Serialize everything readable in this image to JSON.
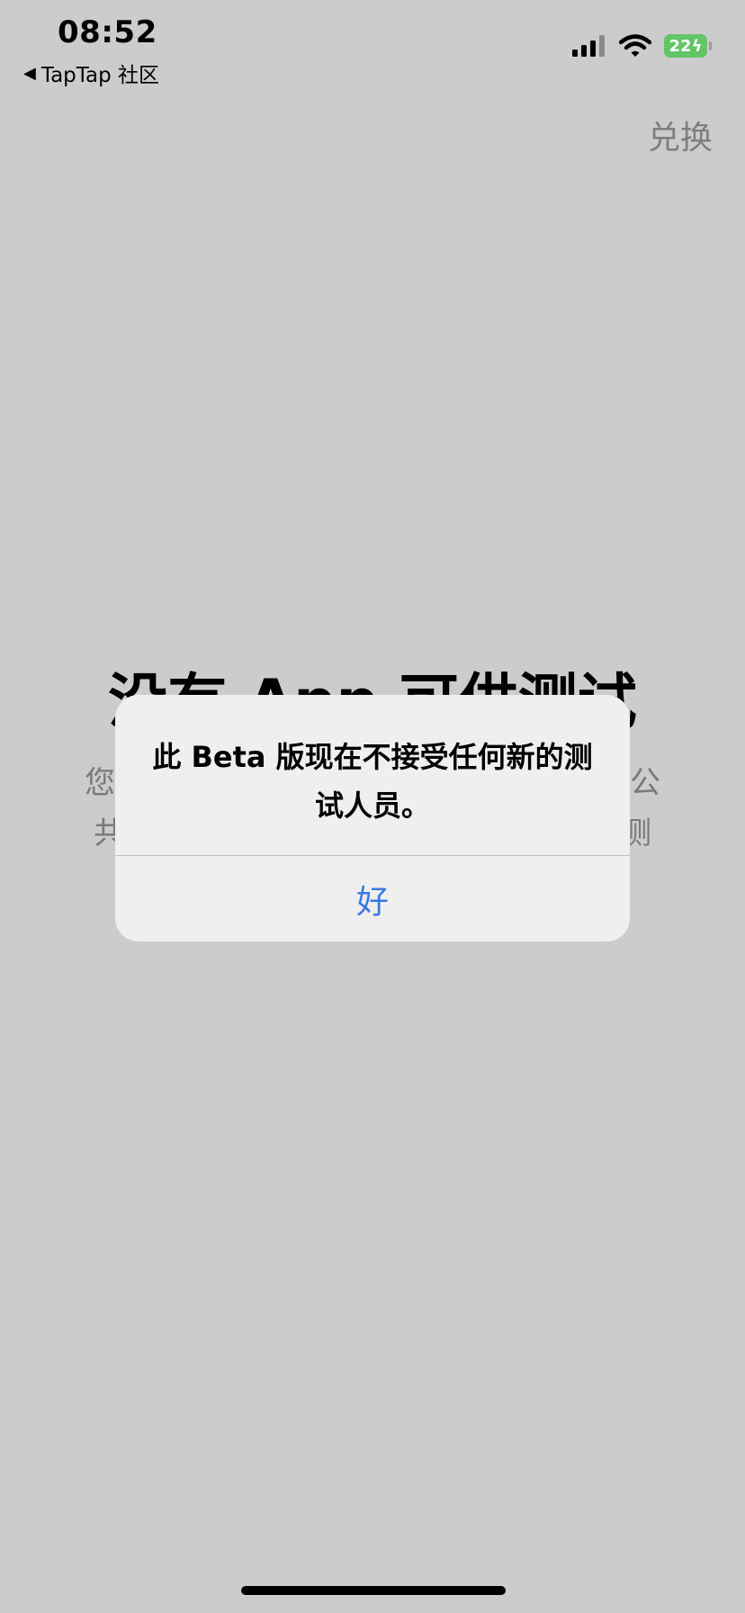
{
  "status_bar": {
    "time": "08:52",
    "back_label": "TapTap 社区",
    "battery": "22"
  },
  "header": {
    "redeem_label": "兑换"
  },
  "background": {
    "title": "没有 App 可供测试",
    "desc_line1_start": "您",
    "desc_line1_end": "公",
    "desc_line2_start": "共",
    "desc_line2_end": "测"
  },
  "alert": {
    "message": "此 Beta 版现在不接受任何新的测试人员。",
    "ok_label": "好"
  },
  "colors": {
    "background": "#cccccc",
    "alert_bg": "#efefef",
    "accent_blue": "#3a7be0",
    "battery_green": "#62c566"
  }
}
